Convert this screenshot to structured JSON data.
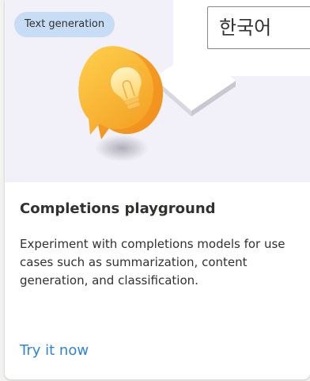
{
  "card": {
    "tag": "Text generation",
    "title": "Completions playground",
    "description": "Experiment with completions models for use cases such as summarization, content generation, and classification.",
    "link": "Try it now"
  },
  "language_select": {
    "value": "한국어"
  },
  "icons": {
    "illustration": "lightbulb-chat-bubble-icon"
  },
  "colors": {
    "accent": "#2f85d5",
    "tag_bg": "#c7dcf5",
    "hero_bg": "#f2f1f9"
  }
}
